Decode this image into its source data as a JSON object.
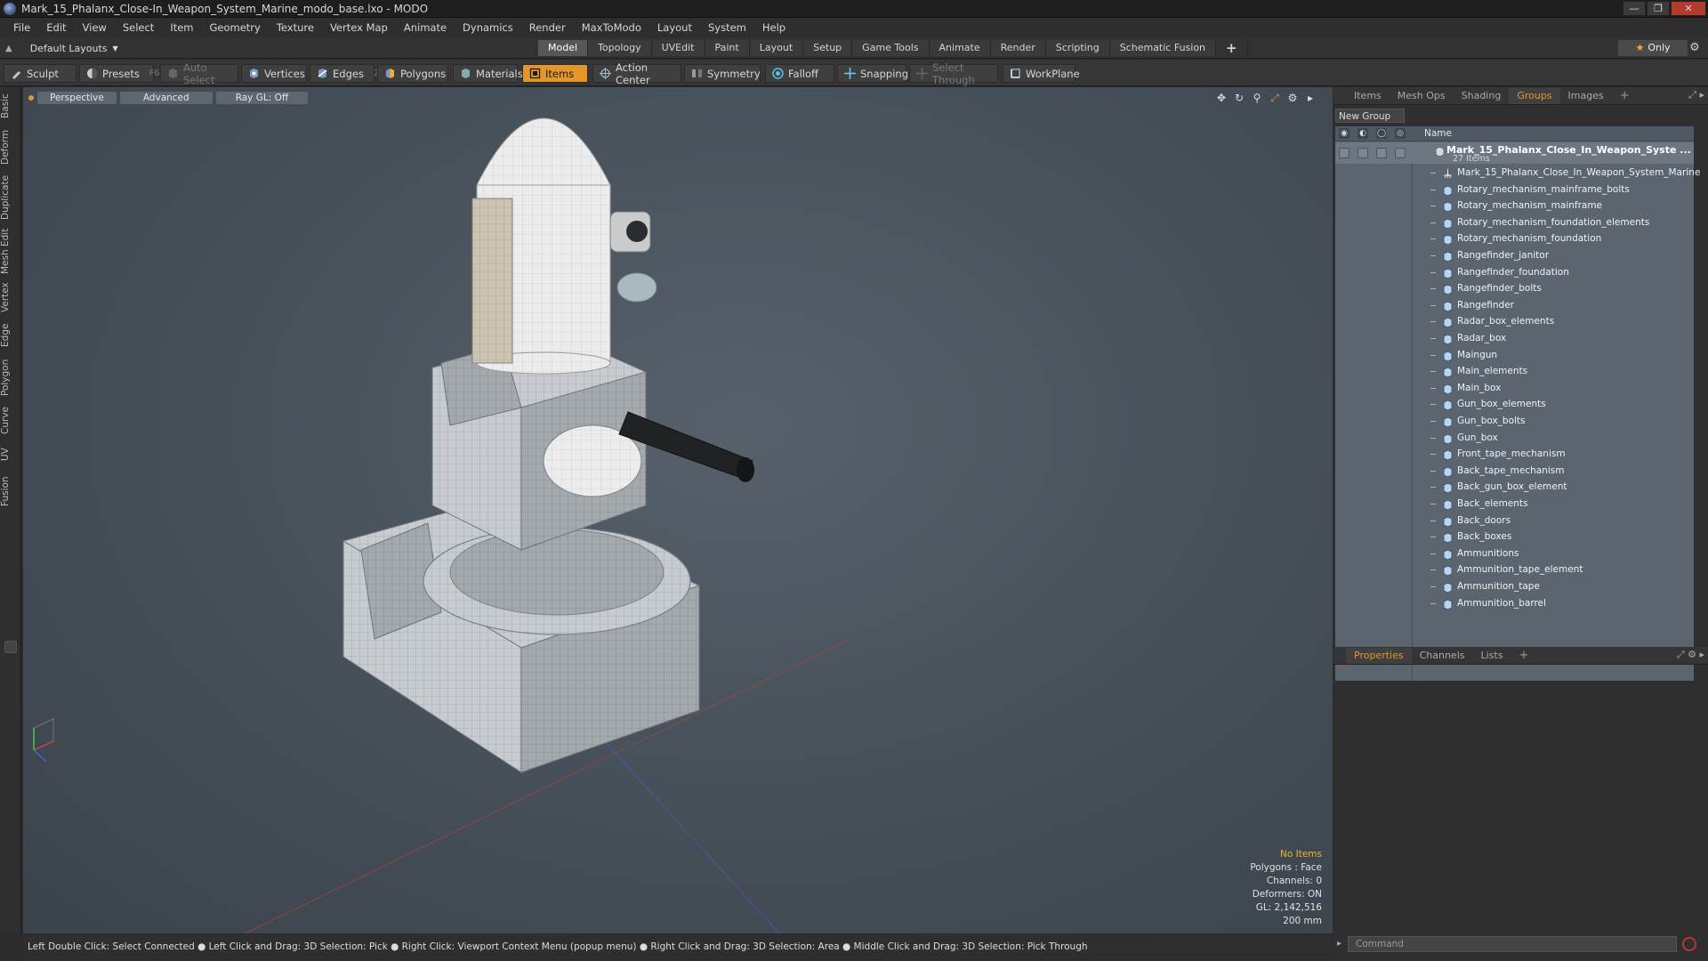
{
  "window": {
    "title": "Mark_15_Phalanx_Close-In_Weapon_System_Marine_modo_base.lxo - MODO"
  },
  "menu": [
    "File",
    "Edit",
    "View",
    "Select",
    "Item",
    "Geometry",
    "Texture",
    "Vertex Map",
    "Animate",
    "Dynamics",
    "Render",
    "MaxToModo",
    "Layout",
    "System",
    "Help"
  ],
  "layout_bar": {
    "layout_select": "Default Layouts",
    "tabs": [
      "Model",
      "Topology",
      "UVEdit",
      "Paint",
      "Layout",
      "Setup",
      "Game Tools",
      "Animate",
      "Render",
      "Scripting",
      "Schematic Fusion"
    ],
    "active_tab": "Model",
    "only_label": "Only"
  },
  "toolbar": {
    "sculpt": "Sculpt",
    "presets": "Presets",
    "presets_key": "F6",
    "auto_select": "Auto Select",
    "vertices": "Vertices",
    "vertices_count": "1",
    "edges": "Edges",
    "edges_count": "2",
    "polygons": "Polygons",
    "materials": "Materials",
    "items": "Items",
    "action_center": "Action Center",
    "symmetry": "Symmetry",
    "falloff": "Falloff",
    "snapping": "Snapping",
    "select_through": "Select Through",
    "workplane": "WorkPlane"
  },
  "left_tabs": [
    "Basic",
    "Deform",
    "Duplicate",
    "Mesh Edit",
    "Vertex",
    "Edge",
    "Polygon",
    "Curve",
    "UV",
    "Fusion"
  ],
  "viewport": {
    "view_mode": "Perspective",
    "shading": "Advanced",
    "raygl": "Ray GL: Off",
    "info": {
      "selection": "No Items",
      "polygons": "Polygons : Face",
      "channels": "Channels: 0",
      "deformers": "Deformers: ON",
      "gl": "GL: 2,142,516",
      "scale": "200 mm"
    }
  },
  "status_bar": "Left Double Click: Select Connected ● Left Click and Drag: 3D Selection: Pick ● Right Click: Viewport Context Menu (popup menu) ● Right Click and Drag: 3D Selection: Area ● Middle Click and Drag: 3D Selection: Pick Through",
  "right_panel": {
    "top_tabs": [
      "Items",
      "Mesh Ops",
      "Shading",
      "Groups",
      "Images"
    ],
    "active_top_tab": "Groups",
    "new_group": "New Group",
    "column_name": "Name",
    "group_title": "Mark_15_Phalanx_Close_In_Weapon_Syste ...",
    "group_count": "27 Items",
    "items": [
      "Mark_15_Phalanx_Close_In_Weapon_System_Marine",
      "Rotary_mechanism_mainframe_bolts",
      "Rotary_mechanism_mainframe",
      "Rotary_mechanism_foundation_elements",
      "Rotary_mechanism_foundation",
      "Rangefinder_janitor",
      "Rangefinder_foundation",
      "Rangefinder_bolts",
      "Rangefinder",
      "Radar_box_elements",
      "Radar_box",
      "Maingun",
      "Main_elements",
      "Main_box",
      "Gun_box_elements",
      "Gun_box_bolts",
      "Gun_box",
      "Front_tape_mechanism",
      "Back_tape_mechanism",
      "Back_gun_box_element",
      "Back_elements",
      "Back_doors",
      "Back_boxes",
      "Ammunitions",
      "Ammunition_tape_element",
      "Ammunition_tape",
      "Ammunition_barrel"
    ],
    "bottom_tabs": [
      "Properties",
      "Channels",
      "Lists"
    ],
    "active_bottom_tab": "Properties",
    "command_placeholder": "Command"
  },
  "colors": {
    "accent": "#e3972b",
    "viewport_bg": "#4d5760",
    "close_button": "#b53a2e"
  }
}
